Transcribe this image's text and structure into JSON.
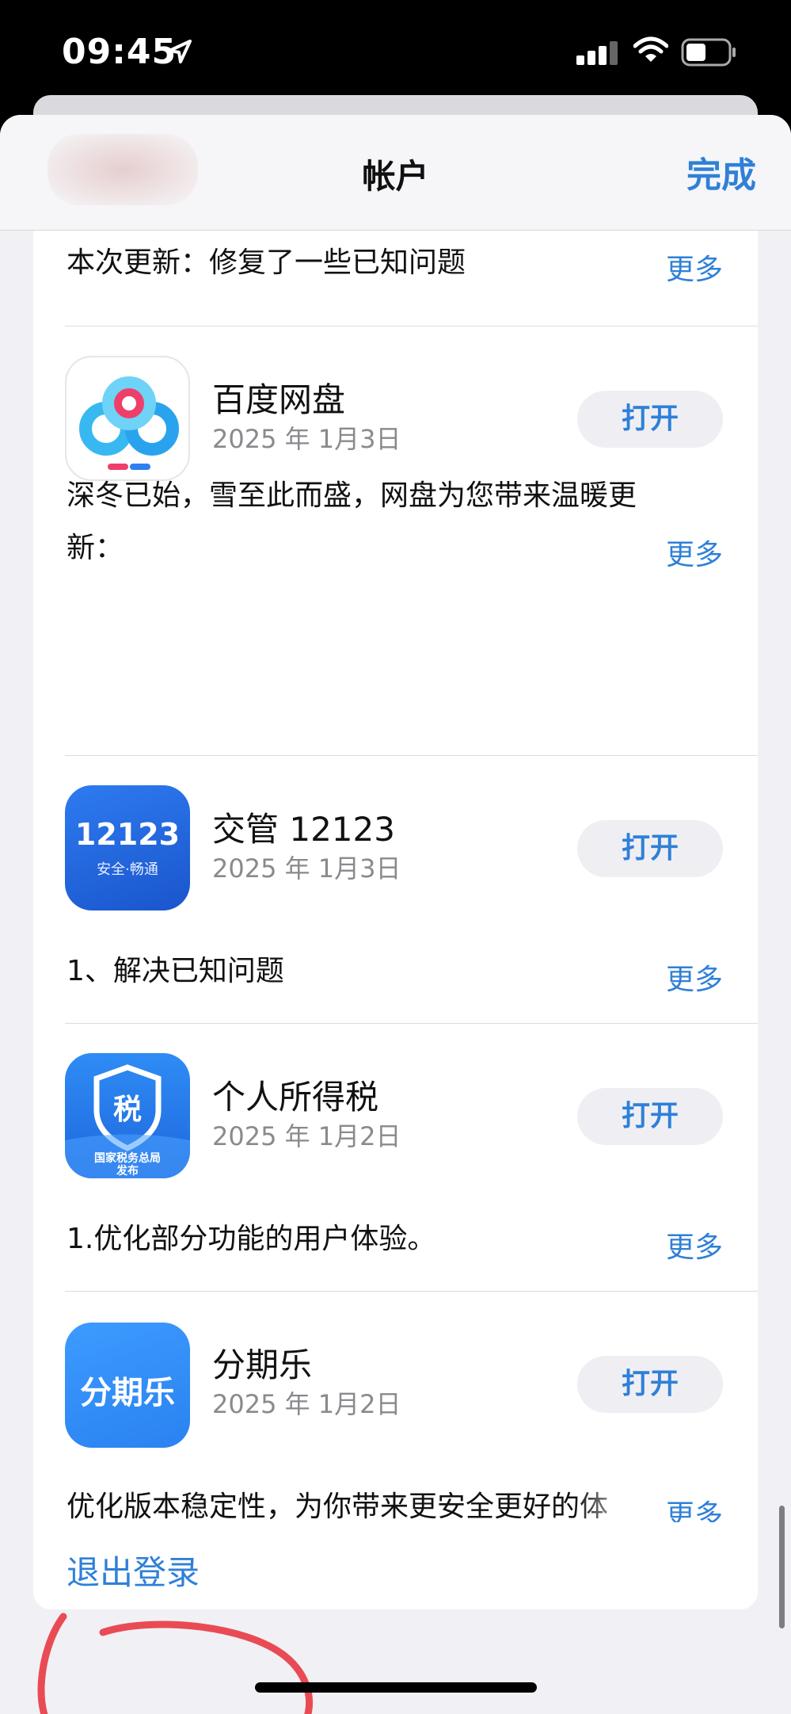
{
  "status_bar": {
    "time": "09:45",
    "icons": [
      "location-arrow-icon",
      "cellular-signal-icon",
      "wifi-icon",
      "battery-icon"
    ]
  },
  "nav": {
    "title": "帐户",
    "done": "完成"
  },
  "colors": {
    "accent": "#2f80d8",
    "annotation": "#e94b55"
  },
  "top_note": {
    "text": "本次更新：修复了一些已知问题",
    "more": "更多"
  },
  "apps": [
    {
      "name": "百度网盘",
      "date": "2025 年 1月3日",
      "button": "打开",
      "note_line1": "深冬已始，雪至此而盛，网盘为您带来温暖更",
      "note_line2": "新：",
      "more": "更多"
    },
    {
      "name": "交管 12123",
      "date": "2025 年 1月3日",
      "button": "打开",
      "icon_text": "12123",
      "icon_subtext": "安全·畅通",
      "note_line1": "1、解决已知问题",
      "more": "更多"
    },
    {
      "name": "个人所得税",
      "date": "2025 年 1月2日",
      "button": "打开",
      "icon_text": "税",
      "icon_subtext": "国家税务总局",
      "icon_subtext2": "发布",
      "note_line1": "1.优化部分功能的用户体验。",
      "more": "更多"
    },
    {
      "name": "分期乐",
      "date": "2025 年 1月2日",
      "button": "打开",
      "icon_text": "分期乐",
      "note_line1": "优化版本稳定性，为你带来更安全更好的体",
      "more": "更多"
    }
  ],
  "logout": {
    "label": "退出登录"
  }
}
